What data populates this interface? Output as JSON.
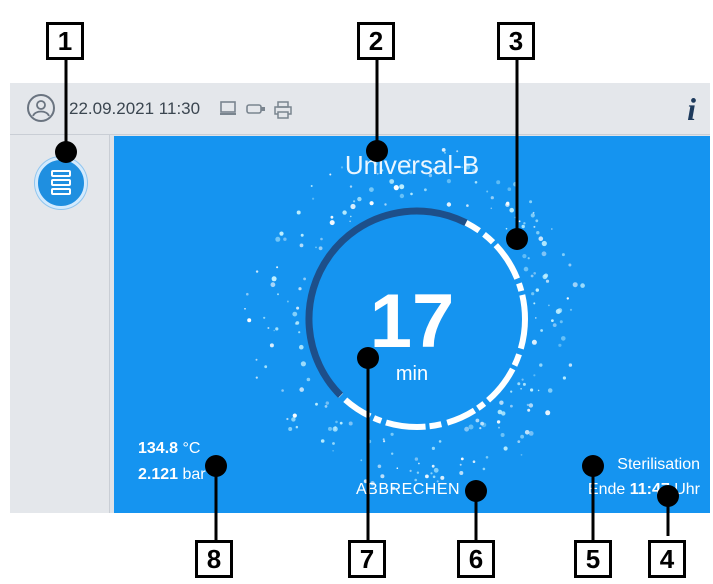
{
  "status_bar": {
    "datetime": "22.09.2021 11:30",
    "info_symbol": "i",
    "icons": [
      "user-icon",
      "display-icon",
      "usb-stick-icon",
      "printer-icon"
    ]
  },
  "sidebar": {
    "menu_button_icon": "menu-list-icon"
  },
  "program": {
    "name": "Universal-B",
    "remaining_time": "17",
    "remaining_unit": "min",
    "progress_fraction": 0.45,
    "temperature_value": "134.8",
    "temperature_unit": "°C",
    "pressure_value": "2.121",
    "pressure_unit": "bar",
    "cancel_label": "ABBRECHEN",
    "phase_label": "Sterilisation",
    "end_prefix": "Ende",
    "end_time": "11:47",
    "end_suffix": "Uhr"
  },
  "callouts": [
    "1",
    "2",
    "3",
    "4",
    "5",
    "6",
    "7",
    "8"
  ],
  "colors": {
    "accent": "#1594f0",
    "ring": "#ffffff",
    "ring_dark": "#1d4f8a",
    "text_dark": "#3b4650"
  }
}
